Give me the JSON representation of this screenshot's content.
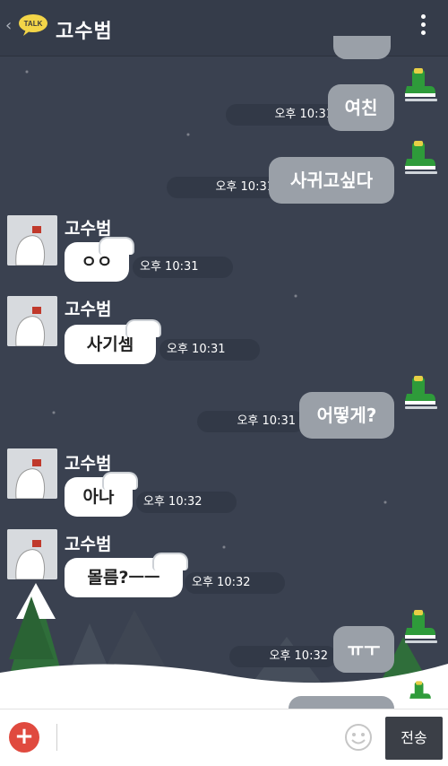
{
  "header": {
    "back_icon": "chevron-left-icon",
    "talk_badge": "TALK",
    "title": "고수범",
    "menu_icon": "more-vertical-icon"
  },
  "messages": {
    "m1": {
      "text": "여친",
      "time": "오후 10:31"
    },
    "m2": {
      "text": "사귀고싶다",
      "time": "오후 10:31"
    },
    "m3": {
      "name": "고수범",
      "text": "ㅇㅇ",
      "time": "오후 10:31"
    },
    "m4": {
      "name": "고수범",
      "text": "사기셈",
      "time": "오후 10:31"
    },
    "m5": {
      "text": "어떻게?",
      "time": "오후 10:31"
    },
    "m6": {
      "name": "고수범",
      "text": "아나",
      "time": "오후 10:32"
    },
    "m7": {
      "name": "고수범",
      "text": "몰름?ㅡㅡ",
      "time": "오후 10:32"
    },
    "m8": {
      "text": "ㅠㅜ",
      "time": "오후 10:32"
    }
  },
  "inputbar": {
    "plus_label": "+",
    "send_label": "전송"
  },
  "colors": {
    "background": "#3a4150",
    "outgoing_bubble": "#9aa0a8",
    "incoming_bubble": "#ffffff",
    "plus_button": "#e04a3f",
    "send_button": "#3b3f47"
  }
}
